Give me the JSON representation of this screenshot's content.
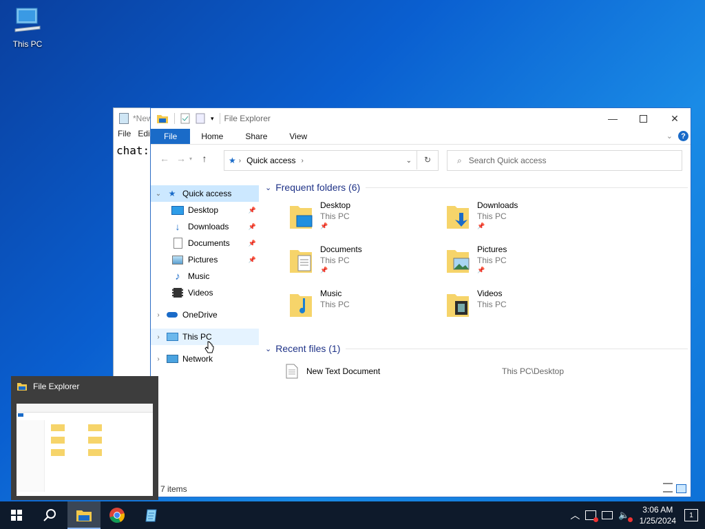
{
  "desktop": {
    "icon_label": "This PC"
  },
  "notepad": {
    "title": "*New",
    "menu": [
      "File",
      "Edi"
    ],
    "text": "chat:"
  },
  "explorer": {
    "title": "File Explorer",
    "tabs": [
      "File",
      "Home",
      "Share",
      "View"
    ],
    "address": {
      "segment": "Quick access"
    },
    "search_placeholder": "Search Quick access",
    "nav": {
      "quick_access": "Quick access",
      "items": [
        "Desktop",
        "Downloads",
        "Documents",
        "Pictures",
        "Music",
        "Videos"
      ],
      "onedrive": "OneDrive",
      "this_pc": "This PC",
      "network": "Network"
    },
    "frequent": {
      "heading": "Frequent folders (6)",
      "folders": [
        {
          "name": "Desktop",
          "location": "This PC",
          "pinned": true,
          "icon": "desktop-folder-icon"
        },
        {
          "name": "Downloads",
          "location": "This PC",
          "pinned": true,
          "icon": "downloads-folder-icon"
        },
        {
          "name": "Documents",
          "location": "This PC",
          "pinned": true,
          "icon": "documents-folder-icon"
        },
        {
          "name": "Pictures",
          "location": "This PC",
          "pinned": true,
          "icon": "pictures-folder-icon"
        },
        {
          "name": "Music",
          "location": "This PC",
          "pinned": false,
          "icon": "music-folder-icon"
        },
        {
          "name": "Videos",
          "location": "This PC",
          "pinned": false,
          "icon": "videos-folder-icon"
        }
      ]
    },
    "recent": {
      "heading": "Recent files (1)",
      "files": [
        {
          "name": "New Text Document",
          "path": "This PC\\Desktop"
        }
      ]
    },
    "status": "7 items"
  },
  "hovercard": {
    "title": "File Explorer"
  },
  "taskbar": {
    "time": "3:06 AM",
    "date": "1/25/2024",
    "notifications": "1"
  },
  "colors": {
    "accent": "#1a6bc8",
    "heading": "#1e3287",
    "selection": "#cce8ff"
  }
}
